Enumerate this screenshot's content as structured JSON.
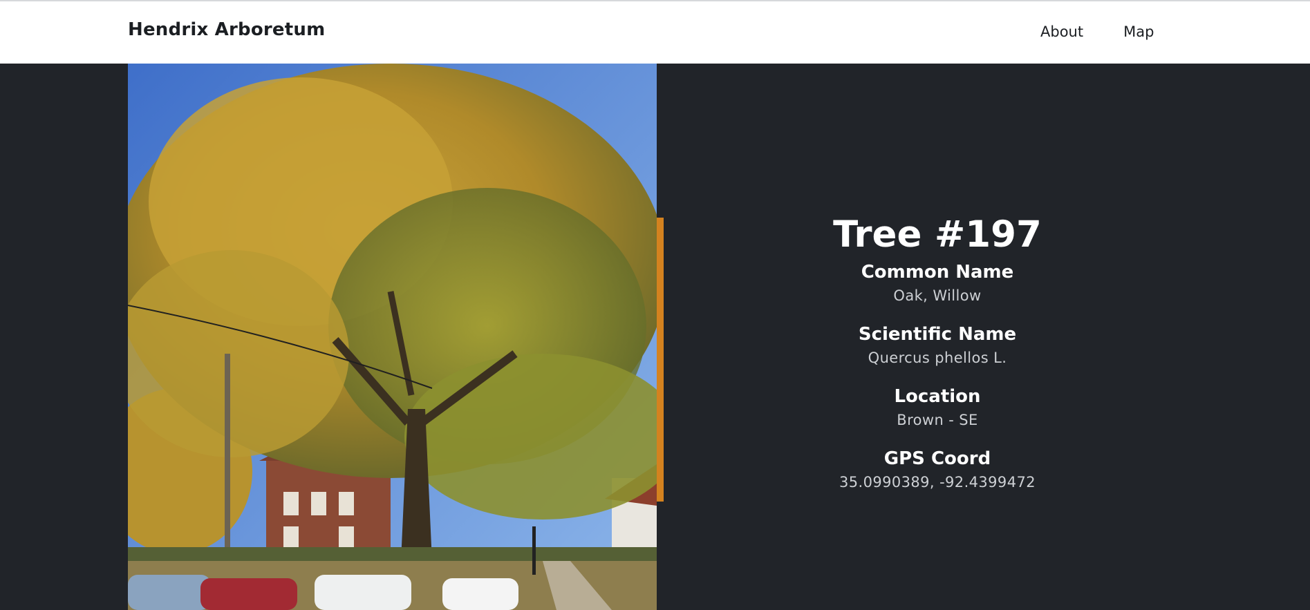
{
  "navbar": {
    "brand": "Hendrix Arboretum",
    "links": [
      {
        "label": "About"
      },
      {
        "label": "Map"
      }
    ]
  },
  "tree": {
    "title": "Tree #197",
    "fields": [
      {
        "label": "Common Name",
        "value": "Oak, Willow"
      },
      {
        "label": "Scientific Name",
        "value": "Quercus phellos L."
      },
      {
        "label": "Location",
        "value": "Brown - SE"
      },
      {
        "label": "GPS Coord",
        "value": "35.0990389, -92.4399472"
      }
    ]
  },
  "colors": {
    "page_background": "#212429",
    "navbar_background": "#ffffff",
    "accent": "#d4821f"
  },
  "icons": {
    "photo": "tree-photo"
  }
}
